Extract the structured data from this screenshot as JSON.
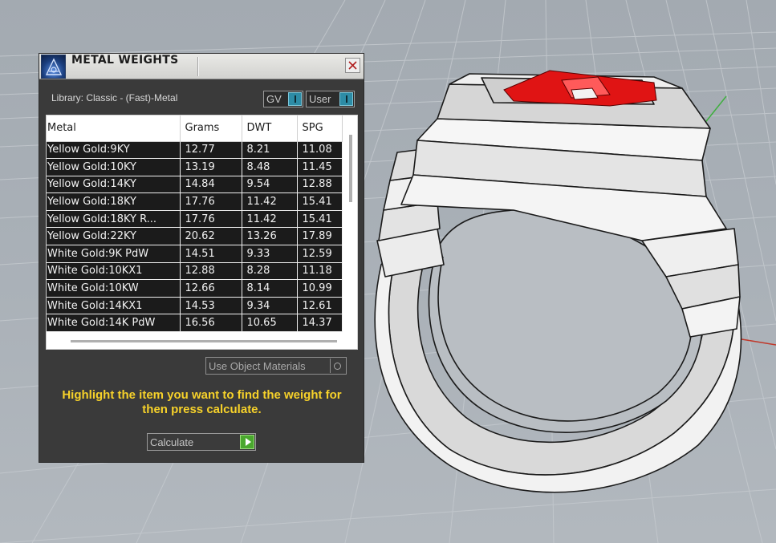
{
  "window": {
    "title": "METAL WEIGHTS",
    "library_label": "Library: Classic - (Fast)-Metal",
    "toggles": {
      "gv": "GV",
      "user": "User"
    }
  },
  "table": {
    "headers": [
      "Metal",
      "Grams",
      "DWT",
      "SPG"
    ],
    "rows": [
      [
        "Yellow Gold:9KY",
        "12.77",
        "8.21",
        "11.08"
      ],
      [
        "Yellow Gold:10KY",
        "13.19",
        "8.48",
        "11.45"
      ],
      [
        "Yellow Gold:14KY",
        "14.84",
        "9.54",
        "12.88"
      ],
      [
        "Yellow Gold:18KY",
        "17.76",
        "11.42",
        "15.41"
      ],
      [
        "Yellow Gold:18KY R...",
        "17.76",
        "11.42",
        "15.41"
      ],
      [
        "Yellow Gold:22KY",
        "20.62",
        "13.26",
        "17.89"
      ],
      [
        "White Gold:9K PdW",
        "14.51",
        "9.33",
        "12.59"
      ],
      [
        "White Gold:10KX1",
        "12.88",
        "8.28",
        "11.18"
      ],
      [
        "White Gold:10KW",
        "12.66",
        "8.14",
        "10.99"
      ],
      [
        "White Gold:14KX1",
        "14.53",
        "9.34",
        "12.61"
      ],
      [
        "White Gold:14K PdW",
        "16.56",
        "10.65",
        "14.37"
      ]
    ]
  },
  "controls": {
    "use_object_materials": "Use Object Materials",
    "instructions": "Highlight the item you want to find the weight for then press calculate.",
    "calculate": "Calculate"
  },
  "colors": {
    "panel_bg": "#3a3a3a",
    "accent_yellow": "#f7d22a",
    "toggle_blue": "#2d8ca6",
    "calculate_green": "#4aa82e",
    "gem_red": "#e01414",
    "grid_x_axis": "#c0392b",
    "grid_y_axis": "#3fae3f"
  },
  "icons": {
    "app": "rhino-logo-icon",
    "close": "close-icon",
    "calculate": "play-icon"
  }
}
